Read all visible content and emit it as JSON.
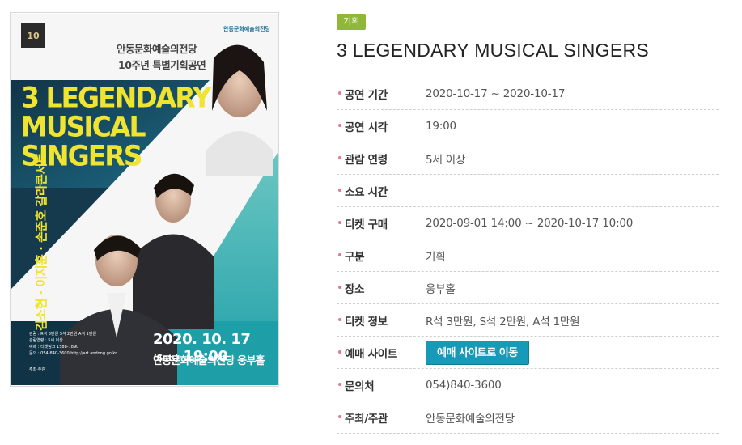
{
  "poster": {
    "logo_text": "10",
    "brand_text": "안동문화예술의전당",
    "subtitle_line1": "안동문화예술의전당",
    "subtitle_line2": "10주년 특별기획공연",
    "title_line1": "3 LEGENDARY",
    "title_line2": "MUSICAL",
    "title_line3": "SINGERS",
    "vertical_text": "김소현 · 이지훈 · 손준호 갈라콘서트",
    "small_info": [
      "관람 : R석 3만원 S석 2만원 A석 1만원",
      "관람연령 : 5세 이상",
      "예매 : 티켓링크 1588-7890",
      "문의 : 054)840-3600  http://art.andong.go.kr"
    ],
    "host_label": "주최·주관",
    "date_text": "2020. 10. 17",
    "date_day": "(Sat.)",
    "date_time": "19:00",
    "venue_text": "안동문화예술의전당 웅부홀",
    "colors": {
      "teal": "#1aa3a9",
      "dark": "#0e2d3f",
      "yellow": "#f0e431"
    }
  },
  "event": {
    "category": "기획",
    "title": "3 LEGENDARY MUSICAL SINGERS"
  },
  "info": [
    {
      "key": "period",
      "label": "공연 기간",
      "value": "2020-10-17 ~ 2020-10-17"
    },
    {
      "key": "time",
      "label": "공연 시각",
      "value": "19:00"
    },
    {
      "key": "age",
      "label": "관람 연령",
      "value": "5세 이상"
    },
    {
      "key": "duration",
      "label": "소요 시간",
      "value": ""
    },
    {
      "key": "ticket-sale",
      "label": "티켓 구매",
      "value": "2020-09-01 14:00 ~ 2020-10-17 10:00"
    },
    {
      "key": "type",
      "label": "구분",
      "value": "기획"
    },
    {
      "key": "venue",
      "label": "장소",
      "value": "웅부홀"
    },
    {
      "key": "ticket-info",
      "label": "티켓 정보",
      "value": "R석 3만원, S석 2만원, A석 1만원"
    },
    {
      "key": "booking-site",
      "label": "예매 사이트",
      "button": "예매 사이트로 이동"
    },
    {
      "key": "contact",
      "label": "문의처",
      "value": "054)840-3600"
    },
    {
      "key": "host",
      "label": "주최/주관",
      "value": "안동문화예술의전당"
    }
  ]
}
